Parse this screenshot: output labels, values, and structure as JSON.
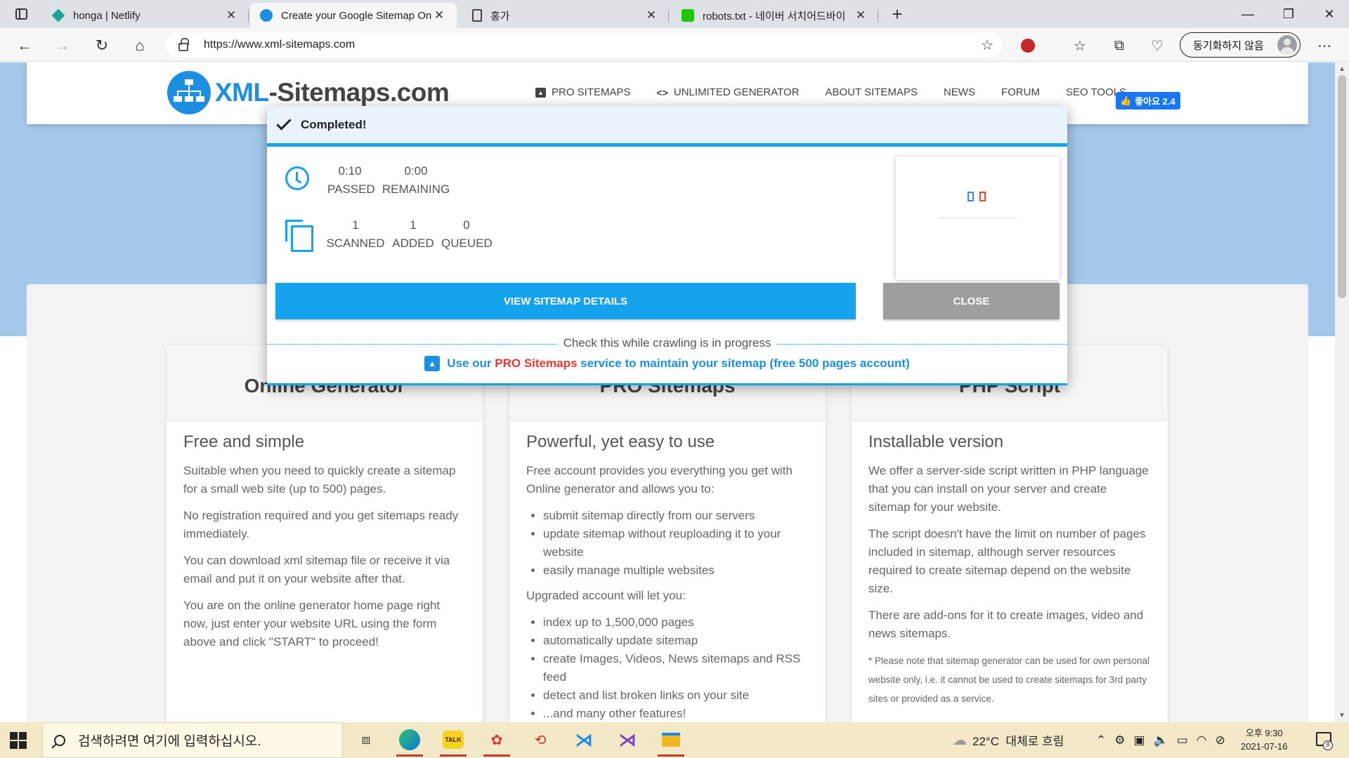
{
  "browser": {
    "tabs": [
      {
        "title": "honga | Netlify",
        "icon": "netlify-icon"
      },
      {
        "title": "Create your Google Sitemap Onl",
        "icon": "xml-sitemaps-icon",
        "active": true
      },
      {
        "title": "홍가",
        "icon": "document-icon"
      },
      {
        "title": "robots.txt - 네이버 서치어드바이",
        "icon": "naver-icon"
      }
    ],
    "new_tab": "+",
    "window_controls": {
      "minimize": "—",
      "maximize": "❐",
      "close": "✕"
    },
    "url": "https://www.xml-sitemaps.com",
    "profile_label": "동기화하지 않음"
  },
  "site": {
    "logo_prefix": "XML",
    "logo_suffix": "-Sitemaps.com",
    "nav": [
      {
        "label": "PRO SITEMAPS",
        "icon": "upload-icon"
      },
      {
        "label": "UNLIMITED GENERATOR",
        "icon": "code-icon"
      },
      {
        "label": "ABOUT SITEMAPS"
      },
      {
        "label": "NEWS"
      },
      {
        "label": "FORUM"
      },
      {
        "label": "SEO TOOLS"
      }
    ],
    "fb_like": "좋아요 2.4"
  },
  "modal": {
    "title": "Completed!",
    "time": {
      "passed": "0:10",
      "passed_label": "PASSED",
      "remaining": "0:00",
      "remaining_label": "REMAINING"
    },
    "pages": {
      "scanned": "1",
      "scanned_label": "SCANNED",
      "added": "1",
      "added_label": "ADDED",
      "queued": "0",
      "queued_label": "QUEUED"
    },
    "view_button": "VIEW SITEMAP DETAILS",
    "close_button": "CLOSE",
    "crawl_note": "Check this while crawling is in progress",
    "promo_pre": "Use our ",
    "promo_red": "PRO Sitemaps",
    "promo_post": " service to maintain your sitemap (free 500 pages account)",
    "accent_color": "#16a3ee"
  },
  "cards": [
    {
      "title": "Online Generator",
      "subtitle": "Free and simple",
      "paragraphs": [
        "Suitable when you need to quickly create a sitemap for a small web site (up to 500) pages.",
        "No registration required and you get sitemaps ready immediately.",
        "You can download xml sitemap file or receive it via email and put it on your website after that.",
        "You are on the online generator home page right now, just enter your website URL using the form above and click \"START\" to proceed!"
      ]
    },
    {
      "title": "PRO Sitemaps",
      "subtitle": "Powerful, yet easy to use",
      "intro": "Free account provides you everything you get with Online generator and allows you to:",
      "list1": [
        "submit sitemap directly from our servers",
        "update sitemap without reuploading it to your website",
        "easily manage multiple websites"
      ],
      "mid": "Upgraded account will let you:",
      "list2": [
        "index up to 1,500,000 pages",
        "automatically update sitemap",
        "create Images, Videos, News sitemaps and RSS feed",
        "detect and list broken links on your site",
        "...and many other features!"
      ]
    },
    {
      "title": "PHP Script",
      "subtitle": "Installable version",
      "paragraphs": [
        "We offer a server-side script written in PHP language that you can install on your server and create sitemap for your website.",
        "The script doesn't have the limit on number of pages included in sitemap, although server resources required to create sitemap depend on the website size.",
        "There are add-ons for it to create images, video and news sitemaps."
      ],
      "note": "* Please note that sitemap generator can be used for own personal website only, i.e. it cannot be used to create sitemaps for 3rd party sites or provided as a service."
    }
  ],
  "taskbar": {
    "search_placeholder": "검색하려면 여기에 입력하십시오.",
    "weather": "22°C  대체로 흐림",
    "time": "오후 9:30",
    "date": "2021-07-16",
    "notifications": "8"
  }
}
